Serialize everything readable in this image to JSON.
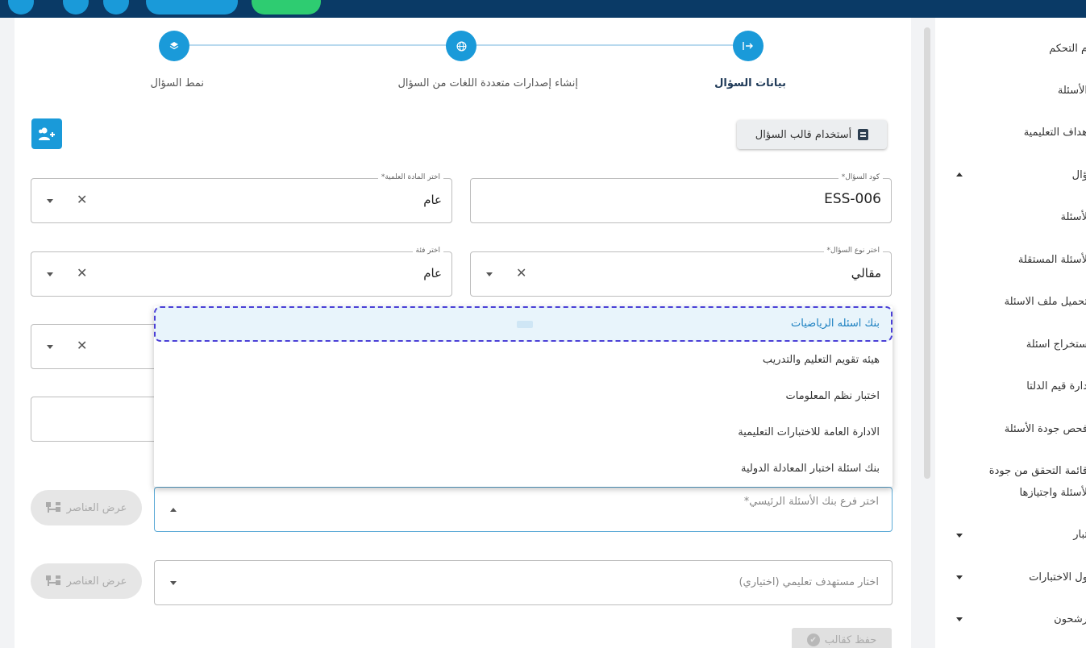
{
  "steps": [
    {
      "label": "بيانات السؤال",
      "icon": "login-icon",
      "active": true
    },
    {
      "label": "إنشاء إصدارات متعددة اللغات من السؤال",
      "icon": "globe-icon",
      "active": false
    },
    {
      "label": "نمط السؤال",
      "icon": "layers-icon",
      "active": false
    }
  ],
  "template_button": "أستخدام قالب السؤال",
  "fields": {
    "question_code": {
      "label": "كود السؤال*",
      "value": "ESS-006"
    },
    "subject": {
      "label": "اختر المادة العلمية*",
      "value": "عام"
    },
    "question_type": {
      "label": "اختر نوع السؤال*",
      "value": "مقالي"
    },
    "category": {
      "label": "اختر فئة",
      "value": "عام"
    },
    "bank_branch": {
      "placeholder": "اختر فرع بنك الأسئلة الرئيسي*"
    },
    "learning_target": {
      "placeholder": "اختار مستهدف تعليمي (اختياري)"
    }
  },
  "dropdown_options": [
    "بنك اسئله الرياضيات",
    "هيئه تقويم التعليم والتدريب",
    "اختبار نظم المعلومات",
    "الادارة العامة للاختبارات التعليمية",
    "بنك اسئلة اختبار المعادلة الدولية"
  ],
  "view_elements_button": "عرض العناصر",
  "save_template_button": "حفظ كقالب",
  "sidebar": [
    {
      "label": "م التحكم"
    },
    {
      "label": "الأسئلة"
    },
    {
      "label": "هداف التعليمية"
    },
    {
      "label": "ؤال",
      "arrow": "up"
    },
    {
      "label": "لأسئلة"
    },
    {
      "label": "لأسئلة المستقلة"
    },
    {
      "label": "تحميل ملف الاسئلة"
    },
    {
      "label": "ستخراج اسئلة"
    },
    {
      "label": "دارة قيم الدلتا"
    },
    {
      "label": "فحص جودة الأسئلة"
    },
    {
      "label": "قائمة التحقق من جودة"
    },
    {
      "label": "لأسئلة واجتيازها"
    },
    {
      "label": "تبار",
      "arrow": "down"
    },
    {
      "label": "ول الاختبارات",
      "arrow": "down"
    },
    {
      "label": "رشحون",
      "arrow": "down"
    }
  ],
  "colors": {
    "topbar": "#0a3a66",
    "accent": "#1a9ad9",
    "green": "#2ecc71"
  }
}
